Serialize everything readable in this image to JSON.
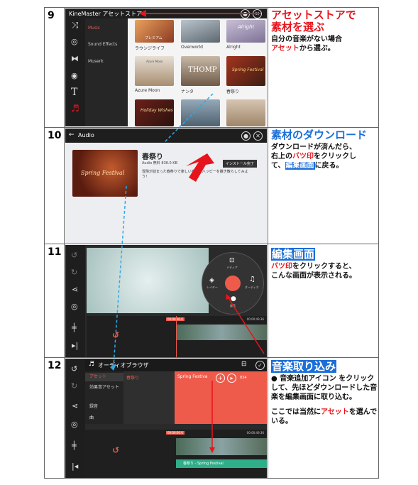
{
  "rows": [
    {
      "number": "9",
      "screen": {
        "title": "KineMaster アセットストア",
        "sidebar": [
          "Music",
          "Sound Effects",
          "Muserk"
        ],
        "assets": [
          {
            "label": "ラウンジライフ",
            "overlay": "プレミアム"
          },
          {
            "label": "Overworld",
            "overlay": ""
          },
          {
            "label": "Alright",
            "overlay": "Alright"
          },
          {
            "label": "Azure Moon",
            "overlay": "Azure Moon"
          },
          {
            "label": "ナンタ",
            "overlay": "THOMP"
          },
          {
            "label": "春祭り",
            "overlay": "Spring Festival"
          },
          {
            "label": "",
            "overlay": "Holiday Wishes"
          },
          {
            "label": "",
            "overlay": ""
          },
          {
            "label": "",
            "overlay": ""
          }
        ]
      },
      "desc": {
        "head_red": "アセットストア",
        "head_rest": "で",
        "head2": "素材を選ぶ",
        "body1": "自分の音楽がない場合",
        "body2_red": "アセット",
        "body2_rest": "から選ぶ。"
      }
    },
    {
      "number": "10",
      "screen": {
        "title": "Audio",
        "item_title": "春祭り",
        "item_meta": "Audio  無料  836.0 KB",
        "install_button": "インストール完了",
        "item_desc": "冒険が詰まった春祭りで楽しい音楽でハッピーを撒き散らしてみよう！",
        "cover_text": "Spring Festival"
      },
      "desc": {
        "head": "素材のダウンロード",
        "line1": "ダウンロードが済んだら、",
        "line2_a": "右上の",
        "line2_red": "バツ印",
        "line2_b": "をクリックし",
        "line3_a": "て、",
        "line3_hl": "編集画面",
        "line3_b": "に戻る。"
      }
    },
    {
      "number": "11",
      "screen": {
        "wheel_center": "メディア",
        "wheel_left": "レイヤー",
        "wheel_right": "オーディオ",
        "wheel_bottom": "録音",
        "time_left": "00:00:00.0",
        "time_right": "00:00:49.36"
      },
      "desc": {
        "head": "編集画面",
        "line1_red": "バツ印",
        "line1_rest": "をクリックすると、",
        "line2": "こんな画面が表示される。"
      }
    },
    {
      "number": "12",
      "screen": {
        "title": "オーディオブラウザ",
        "sidebar": [
          "アセット",
          "効果音アセット",
          "録音",
          "曲"
        ],
        "category": "春祭り",
        "track": "Spring Festiva",
        "track_size": "834",
        "time_left": "00:00:00.0",
        "time_right": "00:00:49.36",
        "timeline_label": "春祭り - Spring Festival"
      },
      "desc": {
        "head": "音楽取り込み",
        "line1": "音楽追加アイコン をクリックして、先ほどダウンロードした音楽を編集画面に取り込む。",
        "line2_a": "ここでは当然に",
        "line2_red": "アセット",
        "line2_b": "を選んでいる。"
      }
    }
  ],
  "colors": {
    "red": "#e8141b",
    "blue": "#1b6fd8",
    "accent": "#ef5b4b"
  }
}
